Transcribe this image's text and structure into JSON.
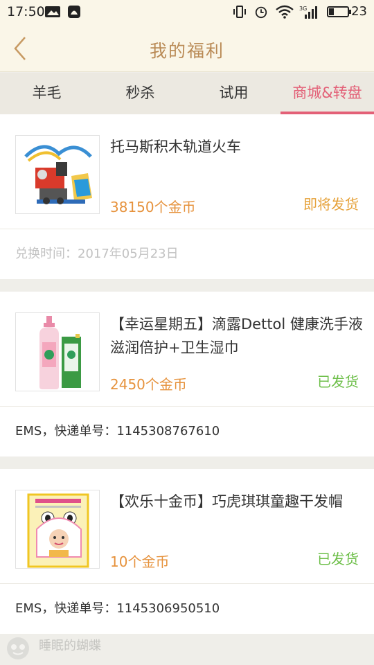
{
  "status_bar": {
    "time": "17:50",
    "battery": "23",
    "network": "3G"
  },
  "header": {
    "title": "我的福利"
  },
  "tabs": [
    {
      "label": "羊毛"
    },
    {
      "label": "秒杀"
    },
    {
      "label": "试用"
    },
    {
      "label": "商城&转盘",
      "active": true
    }
  ],
  "items": [
    {
      "name": "托马斯积木轨道火车",
      "price": "38150个金币",
      "status": "即将发货",
      "detail": "兑换时间：2017年05月23日"
    },
    {
      "name": "【幸运星期五】滴露Dettol 健康洗手液 滋润倍护+卫生湿巾",
      "price": "2450个金币",
      "status": "已发货",
      "detail": "EMS，快递单号：1145308767610"
    },
    {
      "name": "【欢乐十金币】巧虎琪琪童趣干发帽",
      "price": "10个金币",
      "status": "已发货",
      "detail": "EMS，快递单号：1145306950510"
    }
  ],
  "colors": {
    "accent_tab": "#e36077",
    "title": "#b98a55",
    "price": "#e6923c",
    "status_pending": "#e6a23a",
    "status_sent": "#6ebf4a"
  },
  "watermark": {
    "text": "睡眠的蝴蝶"
  }
}
